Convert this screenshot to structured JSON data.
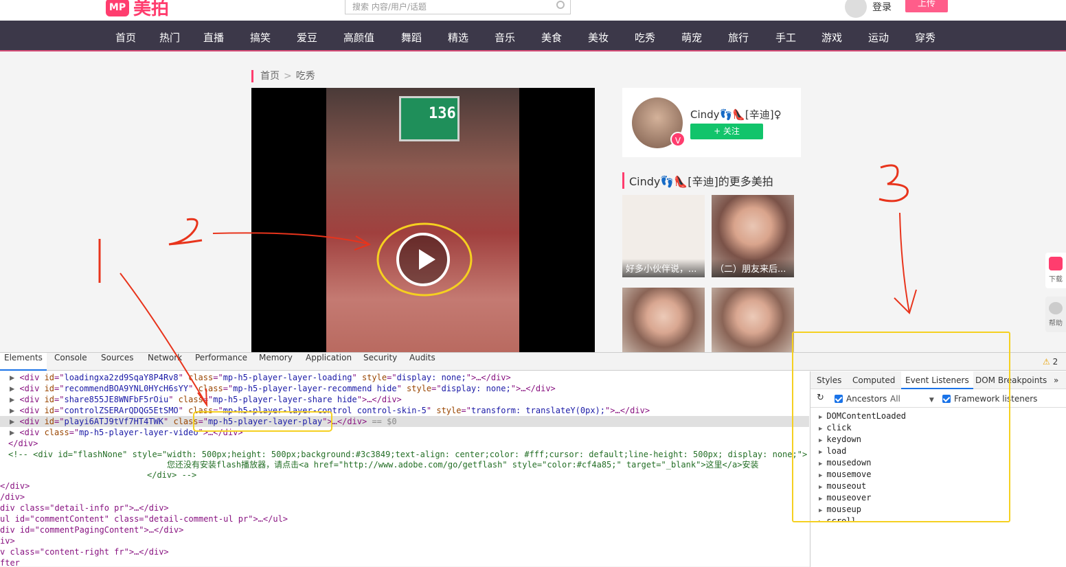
{
  "header": {
    "logo_mark": "MP",
    "logo_text": "美拍",
    "search_placeholder": "搜索 内容/用户/话题",
    "login_label": "登录",
    "upload_label": "上传"
  },
  "nav": [
    "首页",
    "热门",
    "直播",
    "搞笑",
    "爱豆",
    "高颜值",
    "舞蹈",
    "精选",
    "音乐",
    "美食",
    "美妆",
    "吃秀",
    "萌宠",
    "旅行",
    "手工",
    "游戏",
    "运动",
    "穿秀"
  ],
  "breadcrumb": {
    "home": "首页",
    "sep": ">",
    "current": "吃秀"
  },
  "video": {
    "stall_number": "136"
  },
  "user_card": {
    "name": "Cindy👣👠[辛迪]♀",
    "verified_mark": "V",
    "follow_label": "+ 关注"
  },
  "more_section": {
    "title": "Cindy👣👠[辛迪]的更多美拍",
    "items": [
      {
        "caption": "好多小伙伴说，..."
      },
      {
        "caption": "（二）朋友来后..."
      },
      {
        "caption": ""
      },
      {
        "caption": ""
      }
    ]
  },
  "right_float": {
    "download": "下载",
    "help": "帮助"
  },
  "annotations": {
    "one": "1",
    "two": "2",
    "three": "3"
  },
  "devtools": {
    "tabs": [
      "Elements",
      "Console",
      "Sources",
      "Network",
      "Performance",
      "Memory",
      "Application",
      "Security",
      "Audits"
    ],
    "active_tab": "Elements",
    "warning_count": "2",
    "dom_lines": [
      {
        "id": "loadingxa2zd9SqaY8P4Rv8",
        "cls": "mp-h5-player-layer-loading",
        "style": "display: none;",
        "rest": ">…</div>"
      },
      {
        "id": "recommendBOA9YNL0HYcH6sYY",
        "cls": "mp-h5-player-layer-recommend hide",
        "style": "display: none;",
        "rest": ">…</div>"
      },
      {
        "id": "share855JE8WNFbF5rOiu",
        "cls": "mp-h5-player-layer-share hide",
        "rest": ">…</div>"
      },
      {
        "id": "controlZSERArQDQG5EtSMO",
        "cls": "mp-h5-player-layer-control control-skin-5",
        "style": "transform: translateY(0px);",
        "rest": ">…</div>"
      },
      {
        "id": "playi6ATJ9tVf7HT4TWK",
        "cls": "mp-h5-player-layer-play",
        "rest": ">…</div>",
        "sel": "== $0"
      },
      {
        "cls": "mp-h5-player-layer-video",
        "rest": ">…</div>"
      }
    ],
    "close_div": "</div>",
    "comment_1": "<!-- <div id=\"flashNone\" style=\"width: 500px;height: 500px;background:#3c3849;text-align: center;color: #fff;cursor: default;line-height: 500px; display: none;\">",
    "comment_2": "您还没有安装flash播放器，请点击<a href=\"http://www.adobe.com/go/getflash\" style=\"color:#cf4a85;\" target=\"_blank\">这里</a>安装",
    "comment_3": "</div> -->",
    "tail_lines": [
      "</div>",
      "/div>",
      "div class=\"detail-info pr\">…</div>",
      "ul id=\"commentContent\" class=\"detail-comment-ul pr\">…</ul>",
      "div id=\"commentPagingContent\">…</div>",
      "iv>",
      "v class=\"content-right fr\">…</div>",
      "fter"
    ],
    "side_tabs": [
      "Styles",
      "Computed",
      "Event Listeners",
      "DOM Breakpoints",
      "»"
    ],
    "side_active": "Event Listeners",
    "ancestors_label": "Ancestors",
    "all_label": "All",
    "framework_label": "Framework listeners",
    "events": [
      "DOMContentLoaded",
      "click",
      "keydown",
      "load",
      "mousedown",
      "mousemove",
      "mouseout",
      "mouseover",
      "mouseup",
      "scroll"
    ]
  }
}
